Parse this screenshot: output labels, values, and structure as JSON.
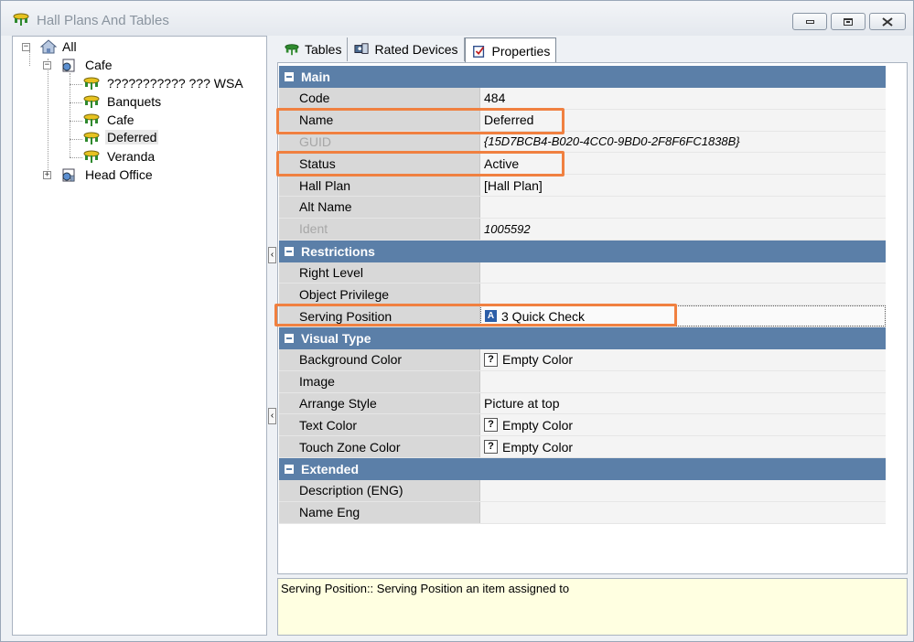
{
  "window": {
    "title": "Hall Plans And Tables"
  },
  "tree": {
    "root": "All",
    "cafe_group": "Cafe",
    "cafe_children": [
      "??????????? ??? WSA",
      "Banquets",
      "Cafe",
      "Deferred",
      "Veranda"
    ],
    "head_office": "Head Office"
  },
  "tabs": [
    {
      "label": "Tables",
      "icon": "table-icon"
    },
    {
      "label": "Rated Devices",
      "icon": "devices-icon"
    },
    {
      "label": "Properties",
      "icon": "properties-icon",
      "active": true
    }
  ],
  "properties": {
    "main": {
      "header": "Main",
      "rows": [
        {
          "name": "Code",
          "value": "484"
        },
        {
          "name": "Name",
          "value": "Deferred"
        },
        {
          "name": "GUID",
          "value": "{15D7BCB4-B020-4CC0-9BD0-2F8F6FC1838B}",
          "disabled": true
        },
        {
          "name": "Status",
          "value": "Active"
        },
        {
          "name": "Hall Plan",
          "value": "[Hall Plan]"
        },
        {
          "name": "Alt Name",
          "value": ""
        },
        {
          "name": "Ident",
          "value": "1005592",
          "disabled": true
        }
      ]
    },
    "restrictions": {
      "header": "Restrictions",
      "rows": [
        {
          "name": "Right Level",
          "value": ""
        },
        {
          "name": "Object Privilege",
          "value": ""
        },
        {
          "name": "Serving Position",
          "value": "3 Quick Check",
          "badge": "A"
        }
      ]
    },
    "visual_type": {
      "header": "Visual Type",
      "rows": [
        {
          "name": "Background Color",
          "value": "Empty Color",
          "q": "?"
        },
        {
          "name": "Image",
          "value": ""
        },
        {
          "name": "Arrange Style",
          "value": "Picture at top"
        },
        {
          "name": "Text Color",
          "value": "Empty Color",
          "q": "?"
        },
        {
          "name": "Touch Zone Color",
          "value": "Empty Color",
          "q": "?"
        }
      ]
    },
    "extended": {
      "header": "Extended",
      "rows": [
        {
          "name": "Description (ENG)",
          "value": ""
        },
        {
          "name": "Name Eng",
          "value": ""
        }
      ]
    }
  },
  "description": "Serving Position:: Serving Position an item assigned to",
  "colors": {
    "category_header": "#5b7fa8",
    "highlight": "#f08040",
    "description_bg": "#ffffe1"
  }
}
